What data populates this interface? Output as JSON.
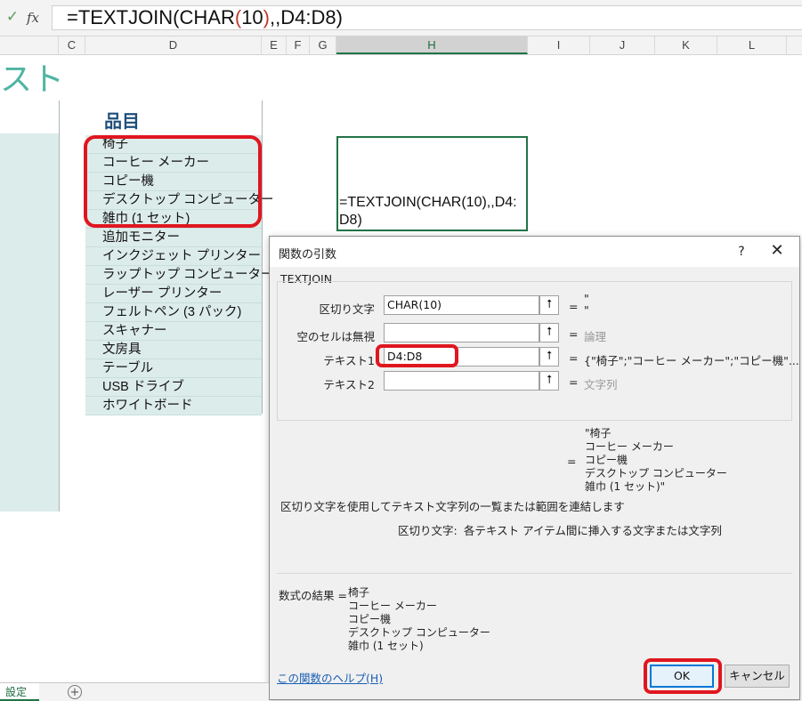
{
  "formula_bar": {
    "check_icon": "check-icon",
    "fx_label": "fx",
    "formula_prefix": "=TEXTJOIN(CHAR",
    "formula_paren_open": "(",
    "formula_inner": "10",
    "formula_paren_close": ")",
    "formula_suffix": ",,D4:D8)"
  },
  "columns": [
    "C",
    "D",
    "E",
    "F",
    "G",
    "H",
    "I",
    "J",
    "K",
    "L"
  ],
  "sheet": {
    "title_fragment": "スト",
    "items_header": "品目",
    "items": [
      "椅子",
      "コーヒー メーカー",
      "コピー機",
      "デスクトップ コンピューター",
      "雑巾 (1 セット)",
      "追加モニター",
      "インクジェット プリンター",
      "ラップトップ コンピューター",
      "レーザー プリンター",
      "フェルトペン (3 パック)",
      "スキャナー",
      "文房具",
      "テーブル",
      "USB ドライブ",
      "ホワイトボード"
    ],
    "h_cell_line1": "=TEXTJOIN(CHAR(10),,D4:",
    "h_cell_line2": "D8)"
  },
  "dialog": {
    "title": "関数の引数",
    "help_glyph": "?",
    "close_glyph": "✕",
    "function_name": "TEXTJOIN",
    "equals": "=",
    "ref_glyph": "⭡",
    "args": [
      {
        "label": "区切り文字",
        "value": "CHAR(10)",
        "result": "\"\n\""
      },
      {
        "label": "空のセルは無視",
        "value": "",
        "result": "論理"
      },
      {
        "label": "テキスト1",
        "value": "D4:D8",
        "result": "{\"椅子\";\"コーヒー メーカー\";\"コピー機\"..."
      },
      {
        "label": "テキスト2",
        "value": "",
        "result": "文字列"
      }
    ],
    "overall_result": "\"椅子\nコーヒー メーカー\nコピー機\nデスクトップ コンピューター\n雑巾 (1 セット)\"",
    "function_description": "区切り文字を使用してテキスト文字列の一覧または範囲を連結します",
    "arg_desc_label": "区切り文字:",
    "arg_desc_text": "各テキスト アイテム間に挿入する文字または文字列",
    "formula_result_label": "数式の結果 =",
    "formula_result_value": "椅子\nコーヒー メーカー\nコピー機\nデスクトップ コンピューター\n雑巾 (1 セット)",
    "help_link": "この関数のヘルプ(H)",
    "ok_label": "OK",
    "cancel_label": "キャンセル"
  },
  "tabs": {
    "active_sheet": "設定",
    "add_glyph": "+"
  },
  "colors": {
    "accent_green": "#217346",
    "band_teal": "#dcecea",
    "highlight_red": "#e0161f",
    "title_teal": "#4fb5a3"
  }
}
